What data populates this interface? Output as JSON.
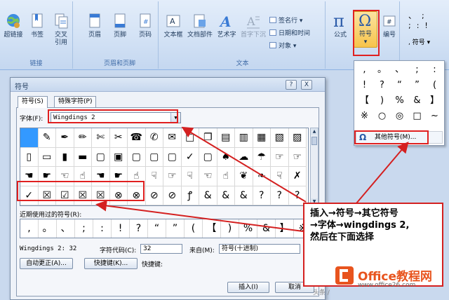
{
  "ribbon": {
    "groups": {
      "links": "链接",
      "header_footer": "页眉和页脚",
      "text": "文本"
    },
    "buttons": {
      "hyperlink": "超链接",
      "bookmark": "书签",
      "cross_ref_1": "交叉",
      "cross_ref_2": "引用",
      "header": "页眉",
      "footer": "页脚",
      "page_number": "页码",
      "textbox": "文本框",
      "quick_parts": "文档部件",
      "wordart": "艺术字",
      "dropcap": "首字下沉",
      "signature_line": "签名行",
      "date_time": "日期和时间",
      "object": "对象",
      "equation": "公式",
      "symbol": "符号",
      "numbering": "编号",
      "symbol_right": "符号"
    },
    "accent": "#1e395b"
  },
  "symbol_dropdown": {
    "cells": [
      ",",
      "。",
      "、",
      ";",
      ":",
      "!",
      "?",
      "“",
      "”",
      "(",
      "【",
      ")",
      "%",
      "&",
      "】",
      "※",
      "○",
      "◎",
      "□",
      "~"
    ],
    "more_label": "其他符号(M)..."
  },
  "dialog": {
    "title": "符号",
    "help_btn": "?",
    "close_btn": "X",
    "tabs": [
      "符号(S)",
      "特殊字符(P)"
    ],
    "font_label": "字体(F):",
    "font_value": "Wingdings 2",
    "symbols": [
      "",
      "✎",
      "✒",
      "✏",
      "✄",
      "✂",
      "☎",
      "✆",
      "✉",
      "□",
      "❐",
      "▤",
      "▥",
      "▦",
      "▧",
      "▨",
      "▯",
      "▭",
      "▮",
      "▬",
      "▢",
      "▣",
      "▢",
      "▢",
      "▢",
      "✓",
      "▢",
      "♠",
      "☁",
      "☂",
      "☞",
      "☞",
      "☚",
      "☛",
      "☜",
      "☝",
      "☚",
      "☛",
      "☝",
      "☟",
      "☞",
      "☟",
      "☜",
      "☝",
      "❦",
      "❧",
      "☟",
      "✗",
      "✓",
      "☒",
      "☑",
      "☒",
      "☒",
      "⊗",
      "⊗",
      "⊘",
      "⊘",
      "ꝭ",
      "&",
      "&",
      "&",
      "?",
      "?",
      "?"
    ],
    "recent_label": "近期使用过的符号(R):",
    "recent": [
      ",",
      "。",
      "、",
      ";",
      ":",
      "!",
      "?",
      "“",
      "”",
      "(",
      "【",
      ")",
      "%",
      "&",
      "】",
      "※"
    ],
    "char_name": "Wingdings 2: 32",
    "char_code_label": "字符代码(C):",
    "char_code": "32",
    "from_label": "来自(M):",
    "from_value": "符号(十进制)",
    "autocorrect_btn": "自动更正(A)...",
    "shortcut_btn": "快捷键(K)...",
    "shortcut_label": "快捷键:",
    "insert_btn": "插入(I)",
    "cancel_btn": "取消"
  },
  "callout": {
    "line1": "插入→符号→其它符号",
    "line2": "→字体→wingdings 2,",
    "line3": "然后在下面选择",
    "border_color": "#d42020"
  },
  "watermark": {
    "brand": "Office教程网",
    "url": "www.office26.com",
    "head": "头条 /"
  }
}
